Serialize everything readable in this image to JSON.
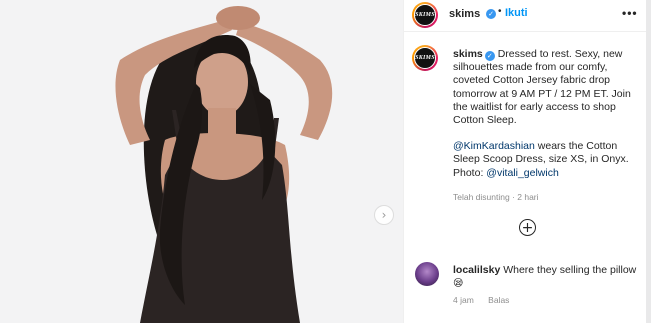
{
  "post": {
    "username": "skims",
    "follow_label": "Ikuti",
    "more_label": "•••",
    "avatar_text": "SKIMS",
    "next_arrow": "›"
  },
  "caption": {
    "username": "skims",
    "text1": "Dressed to rest. Sexy, new silhouettes made from our comfy, coveted Cotton Jersey fabric drop tomorrow at 9 AM PT / 12 PM ET. Join the waitlist for early access to shop Cotton Sleep.",
    "mention1": "@KimKardashian",
    "text2": " wears the Cotton Sleep Scoop Dress, size XS, in Onyx. Photo: ",
    "mention2": "@vitali_gelwich",
    "timestamp": "Telah disunting · 2 hari"
  },
  "actions": {
    "add_icon": "+"
  },
  "comment": {
    "username": "localilsky",
    "text": "Where they selling the pillow",
    "emoji": "😪",
    "time": "4 jam",
    "reply_label": "Balas"
  },
  "colors": {
    "link": "#00376b",
    "follow": "#0095f6",
    "verified": "#3897f0",
    "meta": "#8e8e8e"
  }
}
